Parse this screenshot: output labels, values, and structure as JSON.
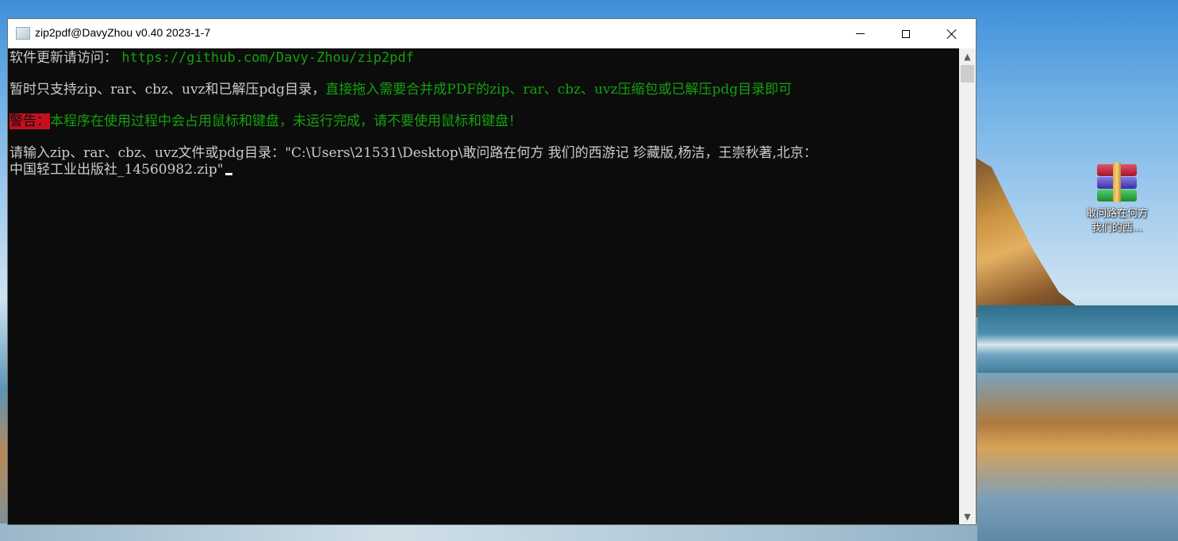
{
  "window": {
    "title": "zip2pdf@DavyZhou v0.40 2023-1-7",
    "icon": "console-app-icon",
    "controls": {
      "minimize": "minimize-icon",
      "maximize": "maximize-icon",
      "close": "close-icon"
    }
  },
  "console": {
    "line1_label": "软件更新请访问：",
    "line1_url": "https://github.com/Davy-Zhou/zip2pdf",
    "line2_white": "暂时只支持zip、rar、cbz、uvz和已解压pdg目录，",
    "line2_green": "直接拖入需要合并成PDF的zip、rar、cbz、uvz压缩包或已解压pdg目录即可",
    "warn_label": "警告：",
    "warn_text": "本程序在使用过程中会占用鼠标和键盘，未运行完成，请不要使用鼠标和键盘！",
    "prompt": "请输入zip、rar、cbz、uvz文件或pdg目录：",
    "input_part1": "\"C:\\Users\\21531\\Desktop\\敢问路在何方  我们的西游记  珍藏版,杨洁，王崇秋著,北京：",
    "input_part2": "中国轻工业出版社_14560982.zip\""
  },
  "scrollbar": {
    "up": "▲",
    "down": "▼"
  },
  "desktop": {
    "icon_label_line1": "敢问路在何方",
    "icon_label_line2": "我们的西...",
    "icon_name": "winrar-archive-icon"
  },
  "colors": {
    "console_bg": "#0c0c0c",
    "console_text": "#cccccc",
    "green": "#13a10e",
    "warn_bg": "#c50f1f"
  }
}
